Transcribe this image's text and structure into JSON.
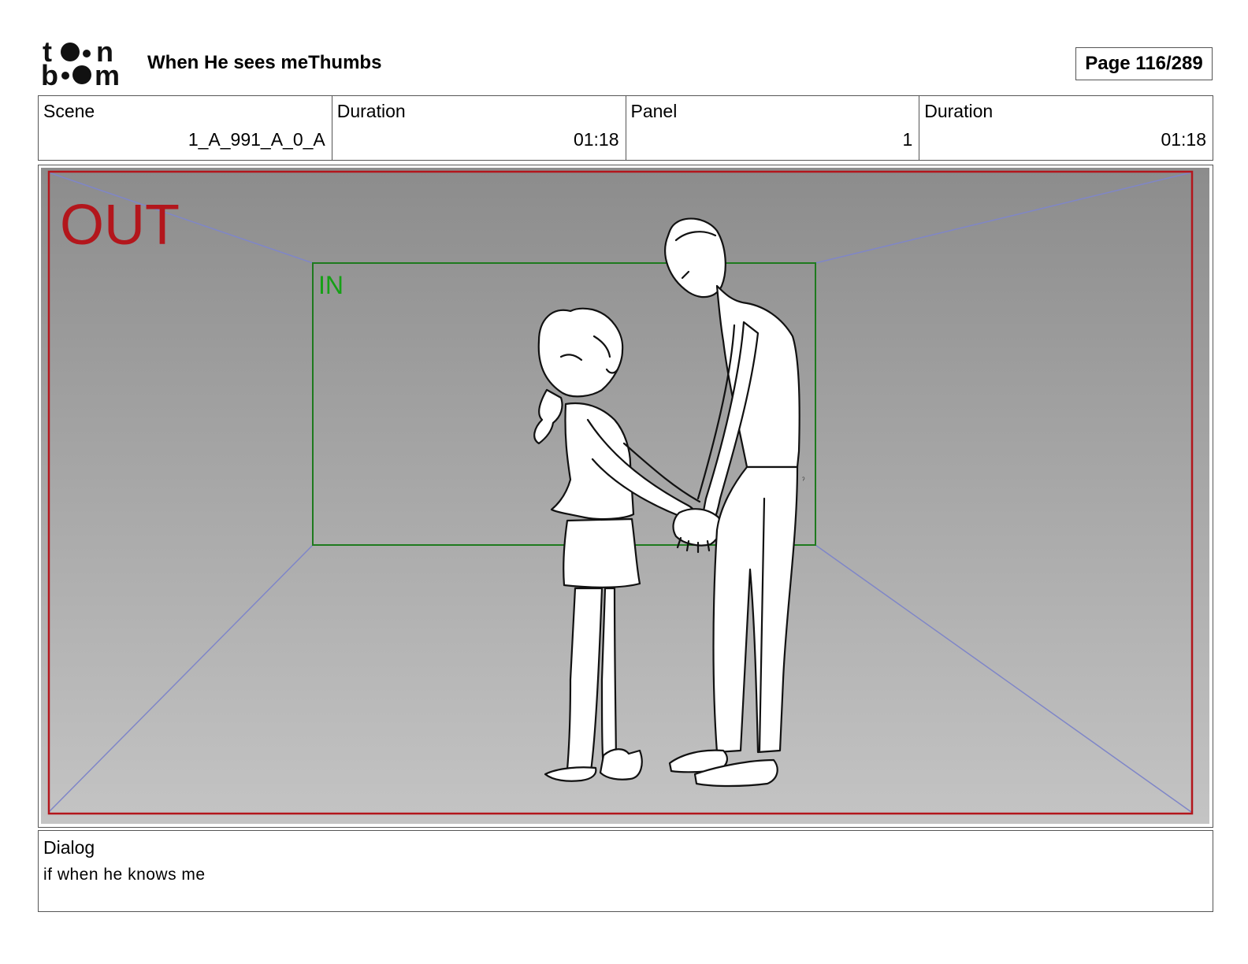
{
  "header": {
    "logo_text": "toonboom",
    "title": "When He sees meThumbs",
    "page_label": "Page 116/289"
  },
  "info": [
    {
      "label": "Scene",
      "value": "1_A_991_A_0_A"
    },
    {
      "label": "Duration",
      "value": "01:18"
    },
    {
      "label": "Panel",
      "value": "1"
    },
    {
      "label": "Duration",
      "value": "01:18"
    }
  ],
  "panel": {
    "out_label": "OUT",
    "in_label": "IN",
    "colors": {
      "out_frame": "#b3161c",
      "in_frame": "#1e7a1e",
      "in_text": "#16a016",
      "perspective_lines": "#7f86c8",
      "background_top": "#8c8c8c",
      "background_bottom": "#c4c4c4"
    }
  },
  "dialog": {
    "label": "Dialog",
    "text": "if when he knows me"
  }
}
